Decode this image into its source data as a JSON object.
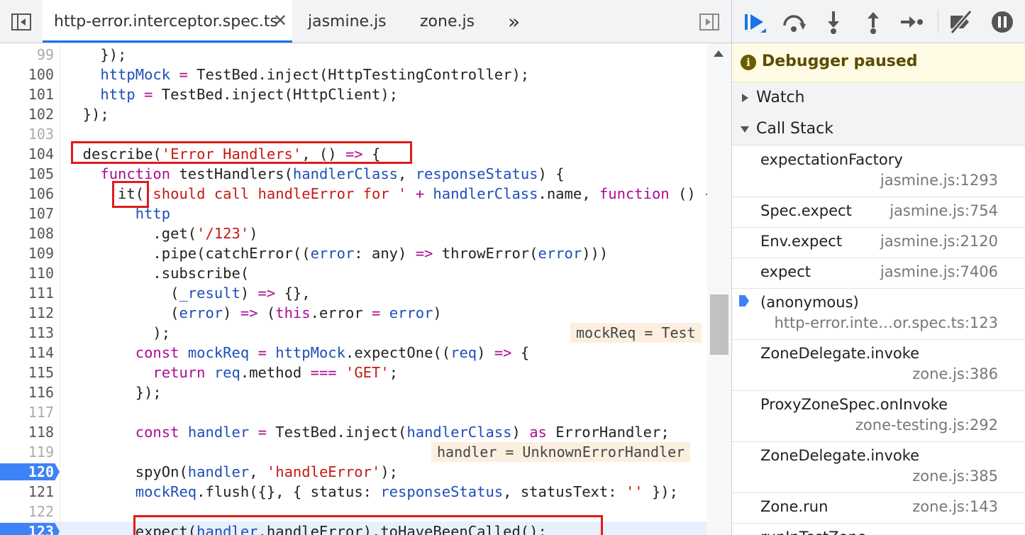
{
  "editor": {
    "tabs": [
      {
        "label": "http-error.interceptor.spec.ts",
        "active": true,
        "closable": true
      },
      {
        "label": "jasmine.js"
      },
      {
        "label": "zone.js"
      }
    ],
    "more_tabs_icon": "»",
    "lines": [
      {
        "n": "99",
        "html": "    });"
      },
      {
        "n": "100",
        "html": "    <span class=\"pm\">httpMock</span> <span class=\"op\">=</span> TestBed.inject(HttpTestingController);"
      },
      {
        "n": "101",
        "html": "    <span class=\"pm\">http</span> <span class=\"op\">=</span> TestBed.inject(HttpClient);"
      },
      {
        "n": "102",
        "html": "  });"
      },
      {
        "n": "103",
        "html": ""
      },
      {
        "n": "104",
        "html": "  describe(<span class=\"st\">'Error Handlers'</span>, () <span class=\"op\">=></span> {"
      },
      {
        "n": "105",
        "html": "    <span class=\"kw\">function</span> testHandlers(<span class=\"pm\">handlerClass</span>, <span class=\"pm\">responseStatus</span>) {"
      },
      {
        "n": "106",
        "html": "      it(<span class=\"st\">'should call handleError for '</span> <span class=\"op\">+</span> <span class=\"pm\">handlerClass</span>.name, <span class=\"kw\">function</span> () {"
      },
      {
        "n": "107",
        "html": "        <span class=\"pm\">http</span>"
      },
      {
        "n": "108",
        "html": "          .get(<span class=\"st\">'/123'</span>)"
      },
      {
        "n": "109",
        "html": "          .pipe(catchError((<span class=\"pm\">error</span>: any) <span class=\"op\">=></span> throwError(<span class=\"pm\">error</span>)))"
      },
      {
        "n": "110",
        "html": "          .subscribe("
      },
      {
        "n": "111",
        "html": "            (<span class=\"pm\">_result</span>) <span class=\"op\">=></span> {},"
      },
      {
        "n": "112",
        "html": "            (<span class=\"pm\">error</span>) <span class=\"op\">=></span> (<span class=\"kw\">this</span>.error <span class=\"op\">=</span> <span class=\"pm\">error</span>)"
      },
      {
        "n": "113",
        "html": "          );"
      },
      {
        "n": "114",
        "html": "        <span class=\"kw\">const</span> <span class=\"pm\">mockReq</span> <span class=\"op\">=</span> <span class=\"pm\">httpMock</span>.expectOne((<span class=\"pm\">req</span>) <span class=\"op\">=></span> {"
      },
      {
        "n": "115",
        "html": "          <span class=\"kw\">return</span> <span class=\"pm\">req</span>.method <span class=\"op\">===</span> <span class=\"st\">'GET'</span>;"
      },
      {
        "n": "116",
        "html": "        });"
      },
      {
        "n": "117",
        "html": ""
      },
      {
        "n": "118",
        "html": "        <span class=\"kw\">const</span> <span class=\"pm\">handler</span> <span class=\"op\">=</span> TestBed.inject(<span class=\"pm\">handlerClass</span>) <span class=\"kw\">as</span> ErrorHandler;"
      },
      {
        "n": "119",
        "html": ""
      },
      {
        "n": "120",
        "html": "        spyOn(<span class=\"pm\">handler</span>, <span class=\"st\">'handleError'</span>);",
        "breakpoint": true
      },
      {
        "n": "121",
        "html": "        <span class=\"pm\">mockReq</span>.flush({}, { status: <span class=\"pm\">responseStatus</span>, statusText: <span class=\"st\">''</span> });"
      },
      {
        "n": "122",
        "html": ""
      },
      {
        "n": "123",
        "html": "        expect(<span class=\"pm\">handler</span>.handleError).toHaveBeenCalled();",
        "breakpoint": true,
        "current": true
      }
    ],
    "inline_values": [
      {
        "line": 14,
        "text": "mockReq = Test"
      },
      {
        "line": 20,
        "text": "handler = UnknownErrorHandler"
      }
    ]
  },
  "debugger": {
    "toolbar_icons": [
      "resume-icon",
      "step-over-icon",
      "step-into-icon",
      "step-out-icon",
      "step-icon",
      "deactivate-breakpoints-icon",
      "pause-on-exceptions-icon"
    ],
    "paused_label": "Debugger paused",
    "watch_label": "Watch",
    "callstack_label": "Call Stack",
    "frames": [
      {
        "name": "expectationFactory",
        "loc": "jasmine.js:1293",
        "two_line": true
      },
      {
        "name": "Spec.expect",
        "loc": "jasmine.js:754"
      },
      {
        "name": "Env.expect",
        "loc": "jasmine.js:2120"
      },
      {
        "name": "expect",
        "loc": "jasmine.js:7406"
      },
      {
        "name": "(anonymous)",
        "loc": "http-error.inte…or.spec.ts:123",
        "two_line": true,
        "current": true
      },
      {
        "name": "ZoneDelegate.invoke",
        "loc": "zone.js:386",
        "two_line": true
      },
      {
        "name": "ProxyZoneSpec.onInvoke",
        "loc": "zone-testing.js:292",
        "two_line": true
      },
      {
        "name": "ZoneDelegate.invoke",
        "loc": "zone.js:385",
        "two_line": true
      },
      {
        "name": "Zone.run",
        "loc": "zone.js:143"
      },
      {
        "name": "runInTestZone",
        "loc": ""
      }
    ]
  }
}
